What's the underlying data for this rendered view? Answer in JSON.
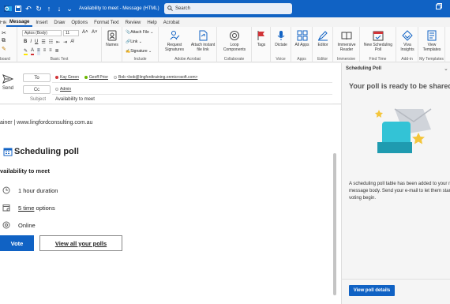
{
  "titlebar": {
    "title": "Availability to meet  -  Message (HTML)",
    "search_placeholder": "Search"
  },
  "tabs": [
    "File",
    "Message",
    "Insert",
    "Draw",
    "Options",
    "Format Text",
    "Review",
    "Help",
    "Acrobat"
  ],
  "ribbon": {
    "font_name": "Aptos (Body)",
    "font_size": "11",
    "groups": {
      "clipboard": "board",
      "basic_text": "Basic Text",
      "names": "Names",
      "include": "Include",
      "adobe": "Adobe Acrobat",
      "collaborate": "Collaborate",
      "tags": "Tags",
      "voice": "Voice",
      "apps": "Apps",
      "editor": "Editor",
      "immersive": "Immersive",
      "find_time": "Find Time",
      "add_in": "Add-in",
      "my_templates": "My Templates"
    },
    "buttons": {
      "names": "Names",
      "attach_file": "Attach File",
      "link": "Link",
      "signature": "Signature",
      "request_signatures": "Request Signatures",
      "attach_instant": "Attach instant file link",
      "loop": "Loop Components",
      "tags": "Tags",
      "dictate": "Dictate",
      "all_apps": "All Apps",
      "editor": "Editor",
      "immersive_reader": "Immersive Reader",
      "new_poll": "New Scheduling Poll",
      "viva": "Viva Insights",
      "view_templates": "View Templates"
    }
  },
  "compose": {
    "send_label": "Send",
    "to_label": "To",
    "cc_label": "Cc",
    "subject_label": "Subject",
    "subject_value": "Availability to meet",
    "to_recipients": [
      {
        "name": "Kay Green",
        "color": "#d13438"
      },
      {
        "name": "Geoff Prior",
        "color": "#6bb700"
      },
      {
        "name": "Bob <bob@lingfordtraining.onmicrosoft.com>",
        "color": "#b0b0b0"
      }
    ],
    "cc_recipients": [
      {
        "name": "Admin",
        "color": "#b0b0b0"
      }
    ]
  },
  "body": {
    "signature": "ainer  |  www.lingfordconsulting.com.au",
    "poll_title": "Scheduling poll",
    "poll_subject": "vailability to meet",
    "options": [
      {
        "icon": "clock-icon",
        "text": "1 hour duration",
        "link": ""
      },
      {
        "icon": "calendar-icon",
        "text": " options",
        "link": "5 time"
      },
      {
        "icon": "location-icon",
        "text": "Online",
        "link": ""
      }
    ],
    "vote_label": "Vote",
    "view_polls_label": "View all your polls"
  },
  "pane": {
    "header": "Scheduling Poll",
    "title": "Your poll is ready to be shared!",
    "text": "A scheduling poll table has been added to your mail message body. Send your e-mail to let them start voting begin.",
    "button": "View poll details"
  },
  "colors": {
    "accent": "#1062c4"
  }
}
